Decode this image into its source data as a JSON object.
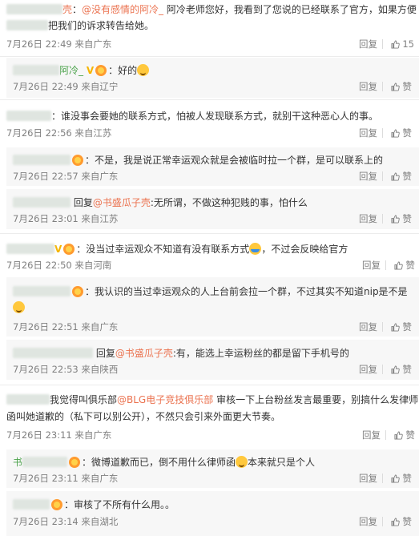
{
  "common": {
    "reply": "回复",
    "like": "赞"
  },
  "comments": [
    {
      "l1a": "：@没有感情的阿冷_阿冷老师您好，我看到了您说的已经联系了官方，如果方便",
      "l1_mention": "@没有感情的阿冷_",
      "l1_text": "阿冷老师您好，我看到了您说的已经联系了官方，如果方便",
      "l2": "把我们的诉求转告给她。",
      "meta": "7月26日 22:49 来自广东",
      "likes": "15"
    },
    {
      "name": "阿冷_",
      "text": "：好的",
      "meta": "7月26日 22:49 来自辽宁"
    },
    {
      "text": "：谁没事会要她的联系方式，怕被人发现联系方式，就别干这种恶心人的事。",
      "meta": "7月26日 22:56 来自江苏"
    },
    {
      "text": "：不是，我是说正常幸运观众就是会被临时拉一个群，是可以联系上的",
      "meta": "7月26日 22:57 来自广东"
    },
    {
      "reply_prefix": "回复",
      "mention": "@书盛瓜子壳",
      "text": ":无所谓，不做这种犯贱的事，怕什么",
      "meta": "7月26日 23:01 来自江苏"
    },
    {
      "text": "：没当过幸运观众不知道有没有联系方式",
      "text2": "，不过会反映给官方",
      "meta": "7月26日 22:50 来自河南"
    },
    {
      "text": "：我认识的当过幸运观众的人上台前会拉一个群，不过其实不知道nip是不是",
      "meta": "7月26日 22:51 来自广东"
    },
    {
      "reply_prefix": "回复",
      "mention": "@书盛瓜子壳",
      "text": ":有，能选上幸运粉丝的都是留下手机号的",
      "meta": "7月26日 22:53 来自陕西"
    },
    {
      "l1a": "我觉得叫俱乐部",
      "l1_mention": "@BLG电子竞技俱乐部",
      "l1b": "审核一下上台粉丝发言最重要，别搞什么发律师",
      "l2": "函叫她道歉的（私下可以别公开），不然只会引来外面更大节奏。",
      "meta": "7月26日 23:11 来自广东"
    },
    {
      "name": "书",
      "text": "：微博道歉而已，倒不用什么律师函",
      "text2": "本来就只是个人",
      "meta": "7月26日 23:11 来自广东"
    },
    {
      "text": "：审核了不所有什么用。。",
      "meta": "7月26日 23:14 来自湖北"
    }
  ]
}
